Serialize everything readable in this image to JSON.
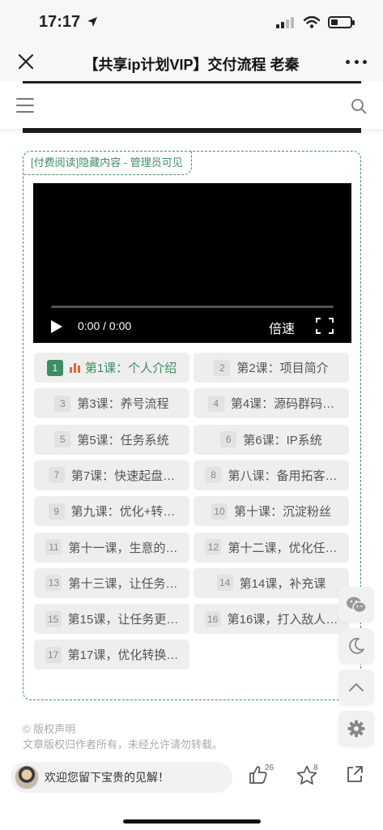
{
  "status_bar": {
    "time": "17:17",
    "battery_level": 0.35
  },
  "titlebar": {
    "title": "【共享ip计划VIP】交付流程 老秦"
  },
  "hidden_content": {
    "tag": "[付费阅读]隐藏内容 - 管理员可见",
    "player": {
      "time": "0:00 / 0:00",
      "speed": "倍速",
      "progress": 0
    },
    "lessons": [
      {
        "num": "1",
        "label": "第1课：个人介绍",
        "active": true
      },
      {
        "num": "2",
        "label": "第2课：项目简介"
      },
      {
        "num": "3",
        "label": "第3课：养号流程"
      },
      {
        "num": "4",
        "label": "第4课：源码群码…"
      },
      {
        "num": "5",
        "label": "第5课：任务系统"
      },
      {
        "num": "6",
        "label": "第6课：IP系统"
      },
      {
        "num": "7",
        "label": "第7课：快速起盘…"
      },
      {
        "num": "8",
        "label": "第八课：备用拓客…"
      },
      {
        "num": "9",
        "label": "第九课：优化+转…"
      },
      {
        "num": "10",
        "label": "第十课：沉淀粉丝"
      },
      {
        "num": "11",
        "label": "第十一课，生意的…"
      },
      {
        "num": "12",
        "label": "第十二课，优化任…"
      },
      {
        "num": "13",
        "label": "第十三课，让任务…"
      },
      {
        "num": "14",
        "label": "第14课，补充课"
      },
      {
        "num": "15",
        "label": "第15课，让任务更…"
      },
      {
        "num": "16",
        "label": "第16课，打入敌人…"
      },
      {
        "num": "17",
        "label": "第17课，优化转换…"
      }
    ]
  },
  "copyright": {
    "title": "© 版权声明",
    "text": "文章版权归作者所有，未经允许请勿转载。"
  },
  "bottom_bar": {
    "comment_placeholder": "欢迎您留下宝贵的见解！",
    "like_count": "26",
    "star_count": "8"
  },
  "colors": {
    "accent": "#3f8d63",
    "active_bars": "#e0672f"
  }
}
